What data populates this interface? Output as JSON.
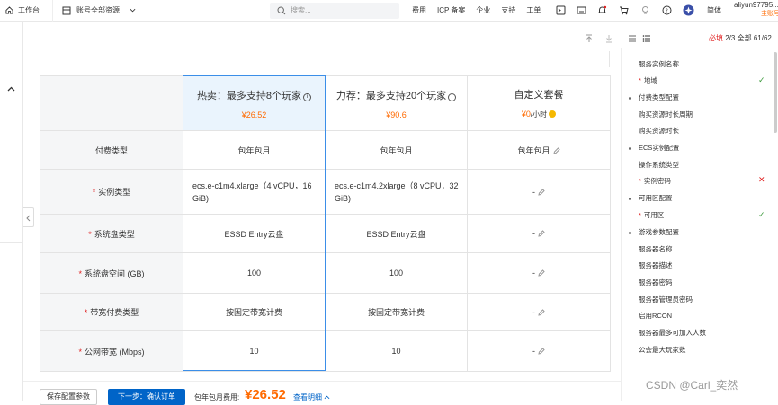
{
  "topbar": {
    "home_label": "工作台",
    "resource_label": "账号全部资源",
    "search_placeholder": "搜索...",
    "nav_links": [
      "费用",
      "ICP 备案",
      "企业",
      "支持",
      "工单"
    ],
    "lang_label": "简体",
    "user_name": "aliyun97795...",
    "user_sub": "主账号"
  },
  "toolbar": {
    "required_label": "必填",
    "required_count": "2/3",
    "all_label": "全部",
    "all_count": "61/62"
  },
  "table": {
    "plans": [
      {
        "title": "热卖：最多支持8个玩家",
        "price": "¥26.52",
        "unit": "",
        "info": "i"
      },
      {
        "title": "力荐：最多支持20个玩家",
        "price": "¥90.6",
        "unit": "",
        "info": "i"
      },
      {
        "title": "自定义套餐",
        "price": "¥0",
        "unit": "/小时",
        "info": ""
      }
    ],
    "rows": [
      {
        "label": "付费类型",
        "required": false,
        "cells": [
          "包年包月",
          "包年包月",
          "包年包月"
        ]
      },
      {
        "label": "实例类型",
        "required": true,
        "cells": [
          "ecs.e-c1m4.xlarge（4 vCPU，16 GiB)",
          "ecs.e-c1m4.2xlarge（8 vCPU，32 GiB)",
          "-"
        ]
      },
      {
        "label": "系统盘类型",
        "required": true,
        "cells": [
          "ESSD Entry云盘",
          "ESSD Entry云盘",
          "-"
        ]
      },
      {
        "label": "系统盘空间 (GB)",
        "required": true,
        "cells": [
          "100",
          "100",
          "-"
        ]
      },
      {
        "label": "带宽付费类型",
        "required": true,
        "cells": [
          "按固定带宽计费",
          "按固定带宽计费",
          "-"
        ]
      },
      {
        "label": "公网带宽 (Mbps)",
        "required": true,
        "cells": [
          "10",
          "10",
          "-"
        ]
      }
    ]
  },
  "footer": {
    "save_label": "保存配置参数",
    "next_label": "下一步：确认订单",
    "fee_label": "包年包月费用:",
    "fee_value": "¥26.52",
    "detail_label": "查看明细"
  },
  "sidebar": {
    "items": [
      {
        "label": "服务实例名称",
        "level": 1,
        "required": false,
        "mark": "",
        "label_red": false
      },
      {
        "label": "地域",
        "level": 1,
        "required": true,
        "mark": "ok",
        "label_red": false
      },
      {
        "label": "付费类型配置",
        "level": 0,
        "required": false,
        "mark": "",
        "label_red": false
      },
      {
        "label": "购买资源时长周期",
        "level": 1,
        "required": false,
        "mark": "",
        "label_red": false
      },
      {
        "label": "购买资源时长",
        "level": 1,
        "required": false,
        "mark": "",
        "label_red": false
      },
      {
        "label": "ECS实例配置",
        "level": 0,
        "required": false,
        "mark": "",
        "label_red": false
      },
      {
        "label": "操作系统类型",
        "level": 1,
        "required": false,
        "mark": "",
        "label_red": false
      },
      {
        "label": "实例密码",
        "level": 1,
        "required": true,
        "mark": "no",
        "label_red": true
      },
      {
        "label": "可用区配置",
        "level": 0,
        "required": false,
        "mark": "",
        "label_red": false
      },
      {
        "label": "可用区",
        "level": 1,
        "required": true,
        "mark": "ok",
        "label_red": false
      },
      {
        "label": "游戏参数配置",
        "level": 0,
        "required": false,
        "mark": "",
        "label_red": false
      },
      {
        "label": "服务器名称",
        "level": 1,
        "required": false,
        "mark": "",
        "label_red": false
      },
      {
        "label": "服务器描述",
        "level": 1,
        "required": false,
        "mark": "",
        "label_red": false
      },
      {
        "label": "服务器密码",
        "level": 1,
        "required": false,
        "mark": "",
        "label_red": false
      },
      {
        "label": "服务器管理员密码",
        "level": 1,
        "required": false,
        "mark": "",
        "label_red": false
      },
      {
        "label": "启用RCON",
        "level": 1,
        "required": false,
        "mark": "",
        "label_red": false
      },
      {
        "label": "服务器最多可加入人数",
        "level": 1,
        "required": false,
        "mark": "",
        "label_red": false
      },
      {
        "label": "公会最大玩家数",
        "level": 1,
        "required": false,
        "mark": "",
        "label_red": false
      }
    ]
  },
  "watermark": "CSDN @Carl_奕然"
}
